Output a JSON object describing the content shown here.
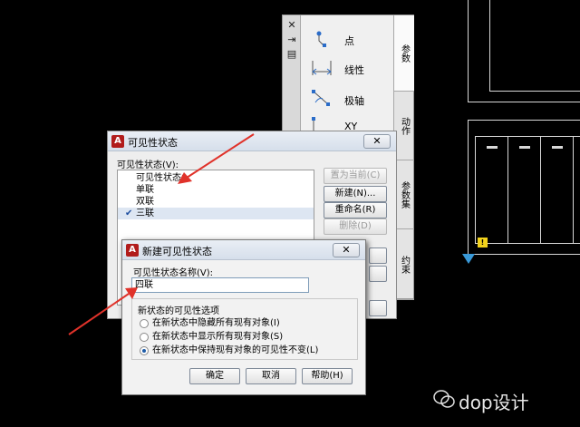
{
  "palette": {
    "tools": [
      {
        "label": "点",
        "icon": "point-parameter-icon"
      },
      {
        "label": "线性",
        "icon": "linear-parameter-icon"
      },
      {
        "label": "极轴",
        "icon": "polar-parameter-icon"
      },
      {
        "label": "XY",
        "icon": "xy-parameter-icon"
      }
    ],
    "tabs": [
      "参数",
      "动作",
      "参数集",
      "约束"
    ]
  },
  "visibility_dialog": {
    "title": "可见性状态",
    "close": "✕",
    "list_label": "可见性状态(V):",
    "states": [
      {
        "label": "可见性状态0",
        "checked": false
      },
      {
        "label": "单联",
        "checked": false
      },
      {
        "label": "双联",
        "checked": false
      },
      {
        "label": "三联",
        "checked": true
      }
    ],
    "buttons": {
      "set_current": "置为当前(C)",
      "new": "新建(N)...",
      "rename": "重命名(R)",
      "delete": "删除(D)"
    }
  },
  "new_state_dialog": {
    "title": "新建可见性状态",
    "close": "✕",
    "name_label": "可见性状态名称(V):",
    "name_value": "四联",
    "options_legend": "新状态的可见性选项",
    "options": [
      {
        "label": "在新状态中隐藏所有现有对象(I)",
        "selected": false
      },
      {
        "label": "在新状态中显示所有现有对象(S)",
        "selected": false
      },
      {
        "label": "在新状态中保持现有对象的可见性不变(L)",
        "selected": true
      }
    ],
    "buttons": {
      "ok": "确定",
      "cancel": "取消",
      "help": "帮助(H)"
    }
  },
  "watermark": "dop设计",
  "colors": {
    "arrow": "#e0322a",
    "cad_line": "#d8d8d8",
    "accent": "#1e5ca8"
  }
}
